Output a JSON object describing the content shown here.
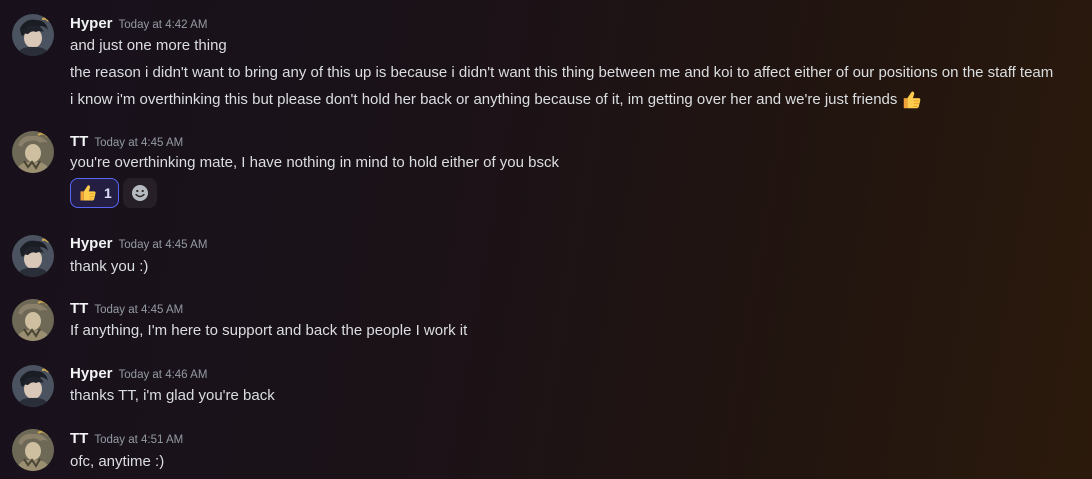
{
  "messages": [
    {
      "author": "Hyper",
      "avatar_icon": "hyper-avatar",
      "time": "Today at 4:42 AM",
      "lines": [
        "and just one more thing",
        "the reason i didn't want to bring any of this up is because i didn't want this thing between me and koi to affect either of our positions on the staff team",
        "i know i'm overthinking this but please don't hold her back or anything because of it, im getting over her and we're just friends"
      ],
      "trailing_emoji": "thumbs-up-icon"
    },
    {
      "author": "TT",
      "avatar_icon": "tt-avatar",
      "time": "Today at 4:45 AM",
      "lines": [
        "you're overthinking mate, I have nothing in mind to hold either of you bsck"
      ],
      "reactions": [
        {
          "emoji": "thumbs-up-icon",
          "count": "1"
        }
      ],
      "add_reaction_icon": "add-reaction-smiley-icon"
    },
    {
      "author": "Hyper",
      "avatar_icon": "hyper-avatar",
      "time": "Today at 4:45 AM",
      "lines": [
        "thank you :)"
      ]
    },
    {
      "author": "TT",
      "avatar_icon": "tt-avatar",
      "time": "Today at 4:45 AM",
      "lines": [
        "If anything, I'm here to support and back the people I work it"
      ]
    },
    {
      "author": "Hyper",
      "avatar_icon": "hyper-avatar",
      "time": "Today at 4:46 AM",
      "lines": [
        "thanks TT, i'm glad you're back"
      ]
    },
    {
      "author": "TT",
      "avatar_icon": "tt-avatar",
      "time": "Today at 4:51 AM",
      "lines": [
        "ofc, anytime :)"
      ]
    }
  ],
  "colors": {
    "username": "#f2f3f5",
    "timestamp": "#949ba4",
    "text": "#dbdee1",
    "reaction_border": "#5865f2"
  }
}
